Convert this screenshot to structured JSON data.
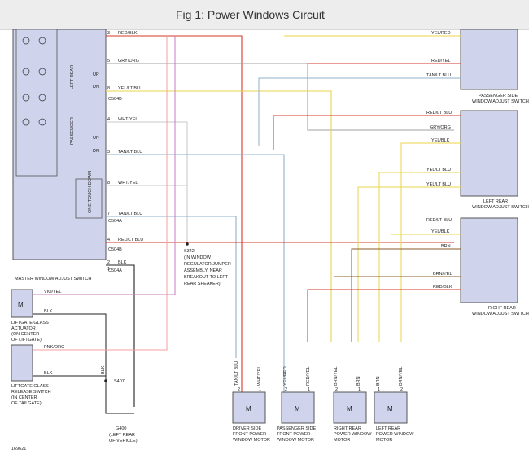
{
  "header": {
    "title": "Fig 1: Power Windows Circuit"
  },
  "master": {
    "label": "MASTER WINDOW ADJUST SWITCH",
    "left_rear": "LEFT REAR",
    "passenger": "PASSENGER",
    "one_touch": "ONE-TOUCH DOWN",
    "up": "UP",
    "dn": "DN",
    "wires": [
      {
        "pin": "3",
        "label": "RED/BLK"
      },
      {
        "pin": "5",
        "label": "GRY/ORG"
      },
      {
        "pin": "8",
        "label": "YEL/LT BLU"
      },
      {
        "pin": "4",
        "label": "WHT/YEL"
      },
      {
        "pin": "3",
        "label": "TAN/LT BLU"
      },
      {
        "pin": "8",
        "label": "WHT/YEL"
      },
      {
        "pin": "7",
        "label": "TAN/LT BLU"
      },
      {
        "pin": "4",
        "label": "RED/LT BLU"
      },
      {
        "pin": "2",
        "label": "BLK"
      },
      {
        "pin": "1",
        "label": ""
      }
    ],
    "connectors": [
      "C504B",
      "C504A",
      "C504B",
      "C504A"
    ]
  },
  "s342": {
    "id": "S342",
    "lines": [
      "(IN WINDOW",
      "REGULATOR JUMPER",
      "ASSEMBLY, NEAR",
      "BREAKOUT TO LEFT",
      "REAR SPEAKER)"
    ]
  },
  "passenger_switch": {
    "label1": "PASSENGER SIDE",
    "label2": "WINDOW ADJUST SWITCH",
    "wires": [
      {
        "pin": "5",
        "label": "YEL/RED"
      },
      {
        "pin": "4",
        "label": "RED/YEL"
      },
      {
        "pin": "1",
        "label": "TAN/LT BLU"
      }
    ]
  },
  "left_rear_switch": {
    "label1": "LEFT REAR",
    "label2": "WINDOW ADJUST SWITCH",
    "wires": [
      {
        "pin": "3",
        "label": "RED/LT BLU"
      },
      {
        "pin": "6",
        "label": "GRY/ORG"
      },
      {
        "pin": "4",
        "label": "YEL/BLK"
      },
      {
        "pin": "2",
        "label": "YEL/LT BLU"
      },
      {
        "pin": "1",
        "label": "YEL/LT BLU"
      }
    ]
  },
  "right_rear_switch": {
    "label1": "RIGHT REAR",
    "label2": "WINDOW ADJUST SWITCH",
    "wires": [
      {
        "pin": "3",
        "label": "RED/LT BLU"
      },
      {
        "pin": "4",
        "label": "YEL/BLK"
      },
      {
        "pin": "5",
        "label": "BRN"
      },
      {
        "pin": "2",
        "label": "BRN/YEL"
      },
      {
        "pin": "1",
        "label": "RED/BLK"
      }
    ]
  },
  "liftgate_actuator": {
    "lines": [
      "LIFTGATE GLASS",
      "ACTUATOR",
      "(ON CENTER",
      "OF LIFTGATE)"
    ],
    "wires": [
      {
        "pin": "1",
        "label": "VIO/YEL"
      },
      {
        "pin": "2",
        "label": "BLK"
      }
    ]
  },
  "liftgate_switch": {
    "lines": [
      "LIFTGATE GLASS",
      "RELEASE SWITCH",
      "(IN CENTER",
      "OF TAILGATE)"
    ],
    "wires": [
      {
        "pin": "1",
        "label": "PNK/ORG"
      },
      {
        "pin": "2",
        "label": "BLK"
      }
    ]
  },
  "ground": {
    "s407": "S407",
    "g400": "G400",
    "g400_lines": [
      "(LEFT REAR",
      "OF VEHICLE)"
    ],
    "blk": "BLK"
  },
  "motors": [
    {
      "lines": [
        "DRIVER SIDE",
        "FRONT POWER",
        "WINDOW MOTOR"
      ],
      "wires": [
        "TAN/LT BLU",
        "WHT/YEL"
      ],
      "pins": [
        "2",
        "1"
      ]
    },
    {
      "lines": [
        "PASSENGER SIDE",
        "FRONT POWER",
        "WINDOW MOTOR"
      ],
      "wires": [
        "YEL/RED",
        "RED/YEL"
      ],
      "pins": [
        "2",
        "1"
      ]
    },
    {
      "lines": [
        "RIGHT REAR",
        "POWER WINDOW",
        "MOTOR"
      ],
      "wires": [
        "BRN/YEL",
        "BRN"
      ],
      "pins": [
        "2",
        "1"
      ]
    },
    {
      "lines": [
        "LEFT REAR",
        "POWER WINDOW",
        "MOTOR"
      ],
      "wires": [
        "BRN",
        "BRN/YEL"
      ],
      "pins": [
        "1",
        "2"
      ]
    }
  ],
  "footer": {
    "code": "169621"
  },
  "icons": {
    "motor": "M"
  },
  "colors": {
    "box_fill": "#cfd3ec",
    "red": "#d43a2a",
    "yellow": "#e8d64a",
    "tan": "#8fb0c8",
    "white": "#c9c9c9",
    "gray": "#a0a0a0",
    "brown": "#8b5a2b",
    "green": "#6fbf6f",
    "violet": "#c77dc7",
    "pink": "#f2a0a0",
    "black": "#222222"
  }
}
